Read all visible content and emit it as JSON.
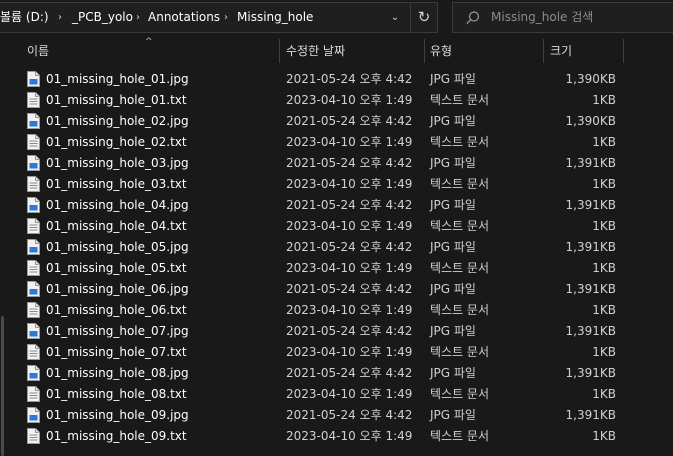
{
  "address": {
    "crumbs": [
      "볼륨 (D:)",
      "_PCB_yolo",
      "Annotations",
      "Missing_hole"
    ],
    "separator": "›",
    "dropdown_glyph": "⌄",
    "refresh_glyph": "↻"
  },
  "search": {
    "placeholder": "Missing_hole 검색",
    "icon": "search-icon"
  },
  "columns": {
    "name": "이름",
    "date": "수정한 날짜",
    "type": "유형",
    "size": "크기",
    "sort_glyph": "^"
  },
  "files": [
    {
      "name": "01_missing_hole_01.jpg",
      "date": "2021-05-24 오후 4:42",
      "type": "JPG 파일",
      "size": "1,390KB",
      "kind": "image"
    },
    {
      "name": "01_missing_hole_01.txt",
      "date": "2023-04-10 오후 1:49",
      "type": "텍스트 문서",
      "size": "1KB",
      "kind": "text"
    },
    {
      "name": "01_missing_hole_02.jpg",
      "date": "2021-05-24 오후 4:42",
      "type": "JPG 파일",
      "size": "1,390KB",
      "kind": "image"
    },
    {
      "name": "01_missing_hole_02.txt",
      "date": "2023-04-10 오후 1:49",
      "type": "텍스트 문서",
      "size": "1KB",
      "kind": "text"
    },
    {
      "name": "01_missing_hole_03.jpg",
      "date": "2021-05-24 오후 4:42",
      "type": "JPG 파일",
      "size": "1,391KB",
      "kind": "image"
    },
    {
      "name": "01_missing_hole_03.txt",
      "date": "2023-04-10 오후 1:49",
      "type": "텍스트 문서",
      "size": "1KB",
      "kind": "text"
    },
    {
      "name": "01_missing_hole_04.jpg",
      "date": "2021-05-24 오후 4:42",
      "type": "JPG 파일",
      "size": "1,391KB",
      "kind": "image"
    },
    {
      "name": "01_missing_hole_04.txt",
      "date": "2023-04-10 오후 1:49",
      "type": "텍스트 문서",
      "size": "1KB",
      "kind": "text"
    },
    {
      "name": "01_missing_hole_05.jpg",
      "date": "2021-05-24 오후 4:42",
      "type": "JPG 파일",
      "size": "1,391KB",
      "kind": "image"
    },
    {
      "name": "01_missing_hole_05.txt",
      "date": "2023-04-10 오후 1:49",
      "type": "텍스트 문서",
      "size": "1KB",
      "kind": "text"
    },
    {
      "name": "01_missing_hole_06.jpg",
      "date": "2021-05-24 오후 4:42",
      "type": "JPG 파일",
      "size": "1,391KB",
      "kind": "image"
    },
    {
      "name": "01_missing_hole_06.txt",
      "date": "2023-04-10 오후 1:49",
      "type": "텍스트 문서",
      "size": "1KB",
      "kind": "text"
    },
    {
      "name": "01_missing_hole_07.jpg",
      "date": "2021-05-24 오후 4:42",
      "type": "JPG 파일",
      "size": "1,391KB",
      "kind": "image"
    },
    {
      "name": "01_missing_hole_07.txt",
      "date": "2023-04-10 오후 1:49",
      "type": "텍스트 문서",
      "size": "1KB",
      "kind": "text"
    },
    {
      "name": "01_missing_hole_08.jpg",
      "date": "2021-05-24 오후 4:42",
      "type": "JPG 파일",
      "size": "1,391KB",
      "kind": "image"
    },
    {
      "name": "01_missing_hole_08.txt",
      "date": "2023-04-10 오후 1:49",
      "type": "텍스트 문서",
      "size": "1KB",
      "kind": "text"
    },
    {
      "name": "01_missing_hole_09.jpg",
      "date": "2021-05-24 오후 4:42",
      "type": "JPG 파일",
      "size": "1,391KB",
      "kind": "image"
    },
    {
      "name": "01_missing_hole_09.txt",
      "date": "2023-04-10 오후 1:49",
      "type": "텍스트 문서",
      "size": "1KB",
      "kind": "text"
    }
  ],
  "colors": {
    "background": "#191919",
    "image_icon_accent": "#2b7bd6",
    "text_primary": "#ffffff",
    "text_secondary": "#d0d0d0"
  }
}
